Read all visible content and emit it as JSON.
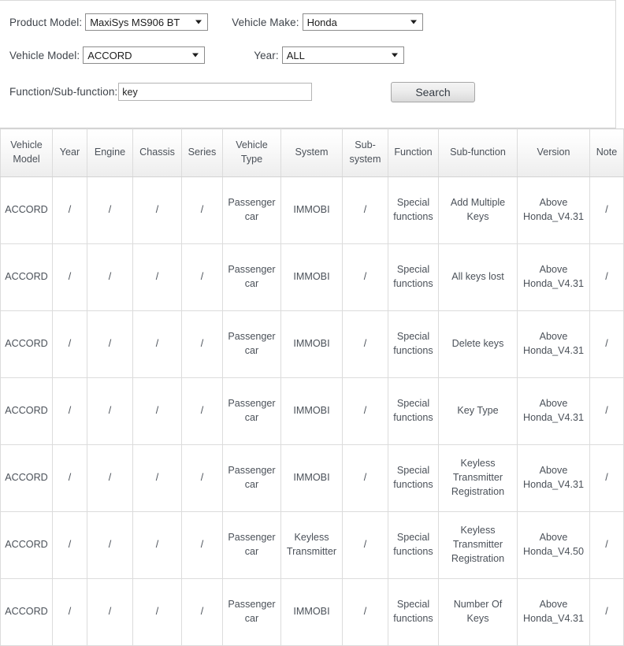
{
  "search_panel": {
    "fields": {
      "product_model_label": "Product Model:",
      "product_model_value": "MaxiSys MS906 BT",
      "vehicle_make_label": "Vehicle Make:",
      "vehicle_make_value": "Honda",
      "vehicle_model_label": "Vehicle Model:",
      "vehicle_model_value": "ACCORD",
      "year_label": "Year:",
      "year_value": "ALL",
      "function_label": "Function/Sub-function:",
      "function_value": "key",
      "function_placeholder": ""
    },
    "search_button_label": "Search"
  },
  "results_table": {
    "columns": [
      "Vehicle Model",
      "Year",
      "Engine",
      "Chassis",
      "Series",
      "Vehicle Type",
      "System",
      "Sub-system",
      "Function",
      "Sub-function",
      "Version",
      "Note"
    ],
    "rows": [
      {
        "vehicle_model": "ACCORD",
        "year": "/",
        "engine": "/",
        "chassis": "/",
        "series": "/",
        "vehicle_type": "Passenger car",
        "system": "IMMOBI",
        "sub_system": "/",
        "function": "Special functions",
        "sub_function": "Add Multiple Keys",
        "version": "Above Honda_V4.31",
        "note": "/"
      },
      {
        "vehicle_model": "ACCORD",
        "year": "/",
        "engine": "/",
        "chassis": "/",
        "series": "/",
        "vehicle_type": "Passenger car",
        "system": "IMMOBI",
        "sub_system": "/",
        "function": "Special functions",
        "sub_function": "All keys lost",
        "version": "Above Honda_V4.31",
        "note": "/"
      },
      {
        "vehicle_model": "ACCORD",
        "year": "/",
        "engine": "/",
        "chassis": "/",
        "series": "/",
        "vehicle_type": "Passenger car",
        "system": "IMMOBI",
        "sub_system": "/",
        "function": "Special functions",
        "sub_function": "Delete keys",
        "version": "Above Honda_V4.31",
        "note": "/"
      },
      {
        "vehicle_model": "ACCORD",
        "year": "/",
        "engine": "/",
        "chassis": "/",
        "series": "/",
        "vehicle_type": "Passenger car",
        "system": "IMMOBI",
        "sub_system": "/",
        "function": "Special functions",
        "sub_function": "Key Type",
        "version": "Above Honda_V4.31",
        "note": "/"
      },
      {
        "vehicle_model": "ACCORD",
        "year": "/",
        "engine": "/",
        "chassis": "/",
        "series": "/",
        "vehicle_type": "Passenger car",
        "system": "IMMOBI",
        "sub_system": "/",
        "function": "Special functions",
        "sub_function": "Keyless Transmitter Registration",
        "version": "Above Honda_V4.31",
        "note": "/"
      },
      {
        "vehicle_model": "ACCORD",
        "year": "/",
        "engine": "/",
        "chassis": "/",
        "series": "/",
        "vehicle_type": "Passenger car",
        "system": "Keyless Transmitter",
        "sub_system": "/",
        "function": "Special functions",
        "sub_function": "Keyless Transmitter Registration",
        "version": "Above Honda_V4.50",
        "note": "/"
      },
      {
        "vehicle_model": "ACCORD",
        "year": "/",
        "engine": "/",
        "chassis": "/",
        "series": "/",
        "vehicle_type": "Passenger car",
        "system": "IMMOBI",
        "sub_system": "/",
        "function": "Special functions",
        "sub_function": "Number Of Keys",
        "version": "Above Honda_V4.31",
        "note": "/"
      }
    ]
  }
}
